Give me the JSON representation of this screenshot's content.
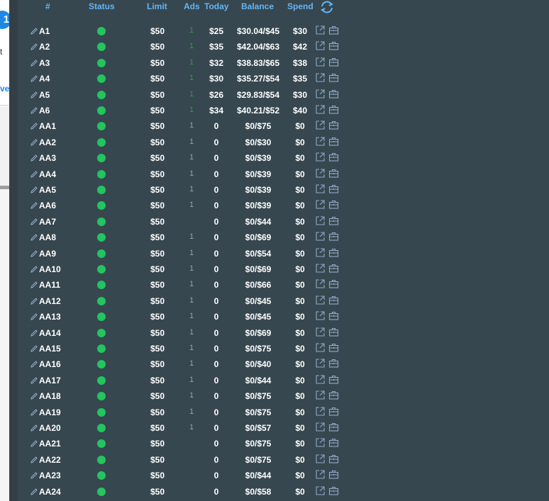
{
  "left_panel": {
    "badge": "1",
    "text1": "t",
    "text2": "ve"
  },
  "header": {
    "hash": "#",
    "status": "Status",
    "limit": "Limit",
    "ads": "Ads",
    "today": "Today",
    "balance": "Balance",
    "spend": "Spend"
  },
  "colors": {
    "background": "#37474f",
    "header_text": "#64b5f6",
    "status_active": "#22c55e",
    "ads_active": "#2e9e3a",
    "ads_inactive": "#90a4ae",
    "icon": "#90aac8"
  },
  "icons": {
    "header": "refresh-icon",
    "row_name": "pencil-icon",
    "row_actions": [
      "external-link-icon",
      "briefcase-icon"
    ]
  },
  "rows": [
    {
      "name": "A1",
      "limit": "$50",
      "ads": "1",
      "ads_active": true,
      "today": "$25",
      "balance": "$30.04/$45",
      "spend": "$30"
    },
    {
      "name": "A2",
      "limit": "$50",
      "ads": "1",
      "ads_active": true,
      "today": "$35",
      "balance": "$42.04/$63",
      "spend": "$42"
    },
    {
      "name": "A3",
      "limit": "$50",
      "ads": "1",
      "ads_active": true,
      "today": "$32",
      "balance": "$38.83/$65",
      "spend": "$38"
    },
    {
      "name": "A4",
      "limit": "$50",
      "ads": "1",
      "ads_active": true,
      "today": "$30",
      "balance": "$35.27/$54",
      "spend": "$35"
    },
    {
      "name": "A5",
      "limit": "$50",
      "ads": "1",
      "ads_active": true,
      "today": "$26",
      "balance": "$29.83/$54",
      "spend": "$30"
    },
    {
      "name": "A6",
      "limit": "$50",
      "ads": "1",
      "ads_active": true,
      "today": "$34",
      "balance": "$40.21/$52",
      "spend": "$40"
    },
    {
      "name": "AA1",
      "limit": "$50",
      "ads": "1",
      "ads_active": false,
      "today": "0",
      "balance": "$0/$75",
      "spend": "$0"
    },
    {
      "name": "AA2",
      "limit": "$50",
      "ads": "1",
      "ads_active": false,
      "today": "0",
      "balance": "$0/$30",
      "spend": "$0"
    },
    {
      "name": "AA3",
      "limit": "$50",
      "ads": "1",
      "ads_active": false,
      "today": "0",
      "balance": "$0/$39",
      "spend": "$0"
    },
    {
      "name": "AA4",
      "limit": "$50",
      "ads": "1",
      "ads_active": false,
      "today": "0",
      "balance": "$0/$39",
      "spend": "$0"
    },
    {
      "name": "AA5",
      "limit": "$50",
      "ads": "1",
      "ads_active": false,
      "today": "0",
      "balance": "$0/$39",
      "spend": "$0"
    },
    {
      "name": "AA6",
      "limit": "$50",
      "ads": "1",
      "ads_active": false,
      "today": "0",
      "balance": "$0/$39",
      "spend": "$0"
    },
    {
      "name": "AA7",
      "limit": "$50",
      "ads": "",
      "ads_active": false,
      "today": "0",
      "balance": "$0/$44",
      "spend": "$0"
    },
    {
      "name": "AA8",
      "limit": "$50",
      "ads": "1",
      "ads_active": false,
      "today": "0",
      "balance": "$0/$69",
      "spend": "$0"
    },
    {
      "name": "AA9",
      "limit": "$50",
      "ads": "1",
      "ads_active": false,
      "today": "0",
      "balance": "$0/$54",
      "spend": "$0"
    },
    {
      "name": "AA10",
      "limit": "$50",
      "ads": "1",
      "ads_active": false,
      "today": "0",
      "balance": "$0/$69",
      "spend": "$0"
    },
    {
      "name": "AA11",
      "limit": "$50",
      "ads": "1",
      "ads_active": false,
      "today": "0",
      "balance": "$0/$66",
      "spend": "$0"
    },
    {
      "name": "AA12",
      "limit": "$50",
      "ads": "1",
      "ads_active": false,
      "today": "0",
      "balance": "$0/$45",
      "spend": "$0"
    },
    {
      "name": "AA13",
      "limit": "$50",
      "ads": "1",
      "ads_active": false,
      "today": "0",
      "balance": "$0/$45",
      "spend": "$0"
    },
    {
      "name": "AA14",
      "limit": "$50",
      "ads": "1",
      "ads_active": false,
      "today": "0",
      "balance": "$0/$69",
      "spend": "$0"
    },
    {
      "name": "AA15",
      "limit": "$50",
      "ads": "1",
      "ads_active": false,
      "today": "0",
      "balance": "$0/$75",
      "spend": "$0"
    },
    {
      "name": "AA16",
      "limit": "$50",
      "ads": "1",
      "ads_active": false,
      "today": "0",
      "balance": "$0/$40",
      "spend": "$0"
    },
    {
      "name": "AA17",
      "limit": "$50",
      "ads": "1",
      "ads_active": false,
      "today": "0",
      "balance": "$0/$44",
      "spend": "$0"
    },
    {
      "name": "AA18",
      "limit": "$50",
      "ads": "1",
      "ads_active": false,
      "today": "0",
      "balance": "$0/$75",
      "spend": "$0"
    },
    {
      "name": "AA19",
      "limit": "$50",
      "ads": "1",
      "ads_active": false,
      "today": "0",
      "balance": "$0/$75",
      "spend": "$0"
    },
    {
      "name": "AA20",
      "limit": "$50",
      "ads": "1",
      "ads_active": false,
      "today": "0",
      "balance": "$0/$57",
      "spend": "$0"
    },
    {
      "name": "AA21",
      "limit": "$50",
      "ads": "",
      "ads_active": false,
      "today": "0",
      "balance": "$0/$75",
      "spend": "$0"
    },
    {
      "name": "AA22",
      "limit": "$50",
      "ads": "",
      "ads_active": false,
      "today": "0",
      "balance": "$0/$75",
      "spend": "$0"
    },
    {
      "name": "AA23",
      "limit": "$50",
      "ads": "",
      "ads_active": false,
      "today": "0",
      "balance": "$0/$44",
      "spend": "$0"
    },
    {
      "name": "AA24",
      "limit": "$50",
      "ads": "",
      "ads_active": false,
      "today": "0",
      "balance": "$0/$58",
      "spend": "$0"
    }
  ]
}
